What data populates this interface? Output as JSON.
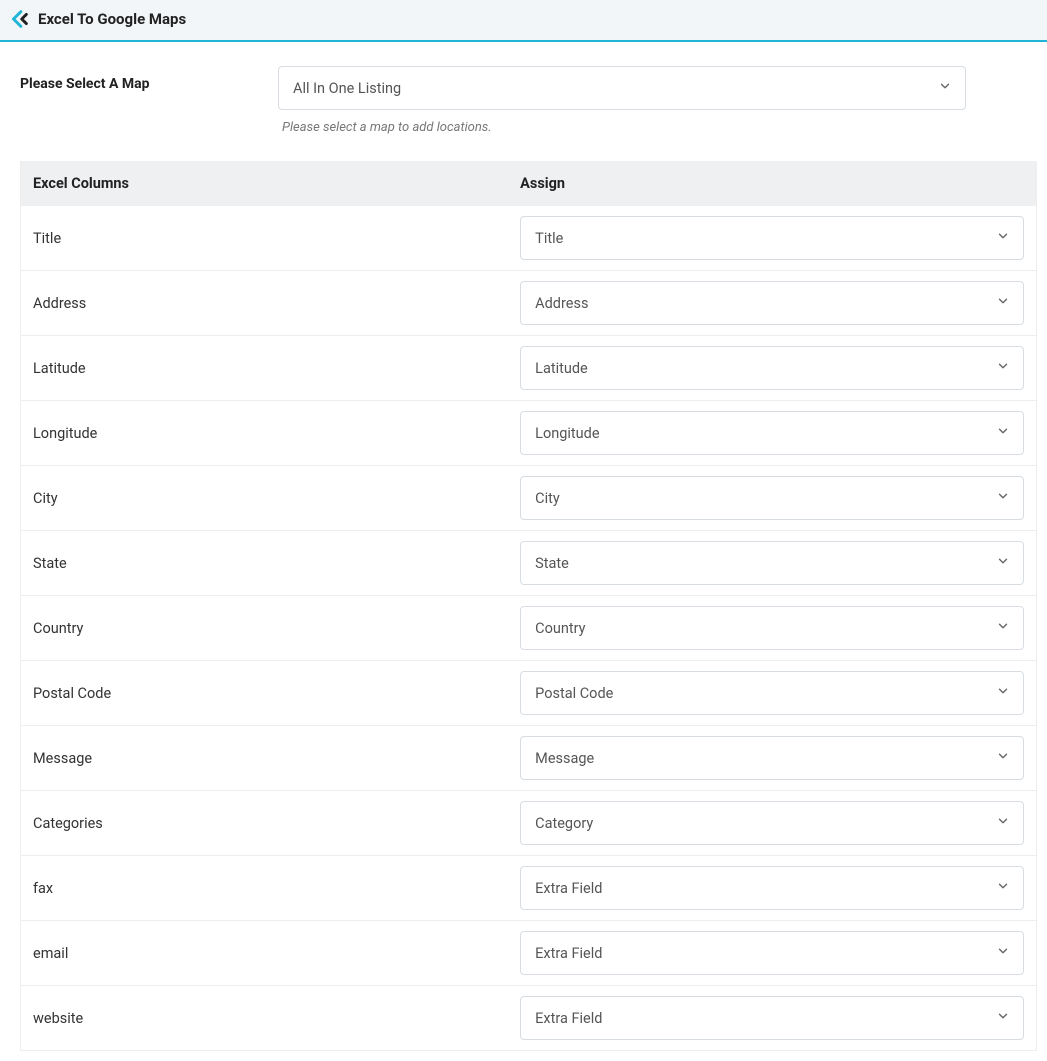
{
  "header": {
    "title": "Excel To Google Maps"
  },
  "selector": {
    "label": "Please Select A Map",
    "value": "All In One Listing",
    "hint": "Please select a map to add locations."
  },
  "table": {
    "col_excel": "Excel Columns",
    "col_assign": "Assign",
    "rows": [
      {
        "label": "Title",
        "value": "Title"
      },
      {
        "label": "Address",
        "value": "Address"
      },
      {
        "label": "Latitude",
        "value": "Latitude"
      },
      {
        "label": "Longitude",
        "value": "Longitude"
      },
      {
        "label": "City",
        "value": "City"
      },
      {
        "label": "State",
        "value": "State"
      },
      {
        "label": "Country",
        "value": "Country"
      },
      {
        "label": "Postal Code",
        "value": "Postal Code"
      },
      {
        "label": "Message",
        "value": "Message"
      },
      {
        "label": "Categories",
        "value": "Category"
      },
      {
        "label": "fax",
        "value": "Extra Field"
      },
      {
        "label": "email",
        "value": "Extra Field"
      },
      {
        "label": "website",
        "value": "Extra Field"
      }
    ]
  }
}
